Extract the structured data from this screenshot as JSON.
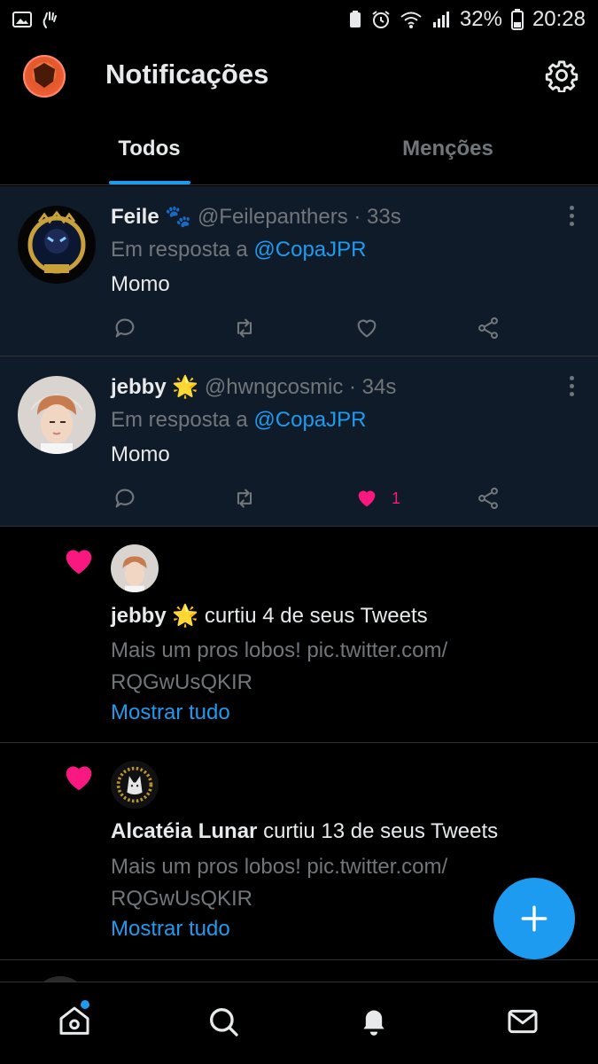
{
  "status_bar": {
    "battery": "32%",
    "time": "20:28",
    "icons": [
      "image-icon",
      "hand-icon",
      "battery-saver-icon",
      "alarm-icon",
      "wifi-icon",
      "signal-icon",
      "battery-icon"
    ]
  },
  "header": {
    "title": "Notificações",
    "settings_icon": "gear-icon"
  },
  "tabs": [
    {
      "label": "Todos",
      "active": true
    },
    {
      "label": "Menções",
      "active": false
    }
  ],
  "tweets": [
    {
      "name": "Feile",
      "emoji": "🐾",
      "handle": "@Feilepanthers · 33s",
      "reply_prefix": "Em resposta a",
      "reply_mention": "@CopaJPR",
      "text": "Momo",
      "likes": "",
      "liked": false
    },
    {
      "name": "jebby",
      "emoji": "🌟",
      "handle": "@hwngcosmic · 34s",
      "reply_prefix": "Em resposta a",
      "reply_mention": "@CopaJPR",
      "text": "Momo",
      "likes": "1",
      "liked": true
    }
  ],
  "notifications": [
    {
      "name": "jebby",
      "emoji": "🌟",
      "action": "curtiu 4 de seus Tweets",
      "snippet": "Mais um pros lobos! pic.twitter.com/ RQGwUsQKIR",
      "show_all": "Mostrar tudo"
    },
    {
      "name": "Alcatéia Lunar",
      "emoji": "",
      "action": "curtiu 13 de seus Tweets",
      "snippet": "Mais um pros lobos! pic.twitter.com/ RQGwUsQKIR",
      "show_all": "Mostrar tudo"
    }
  ],
  "colors": {
    "accent": "#1d9bf0",
    "like": "#f91880",
    "muted": "#71767b",
    "highlight_bg": "#0f1b28"
  },
  "bottom_nav": [
    "home-icon",
    "search-icon",
    "notifications-icon",
    "messages-icon"
  ]
}
